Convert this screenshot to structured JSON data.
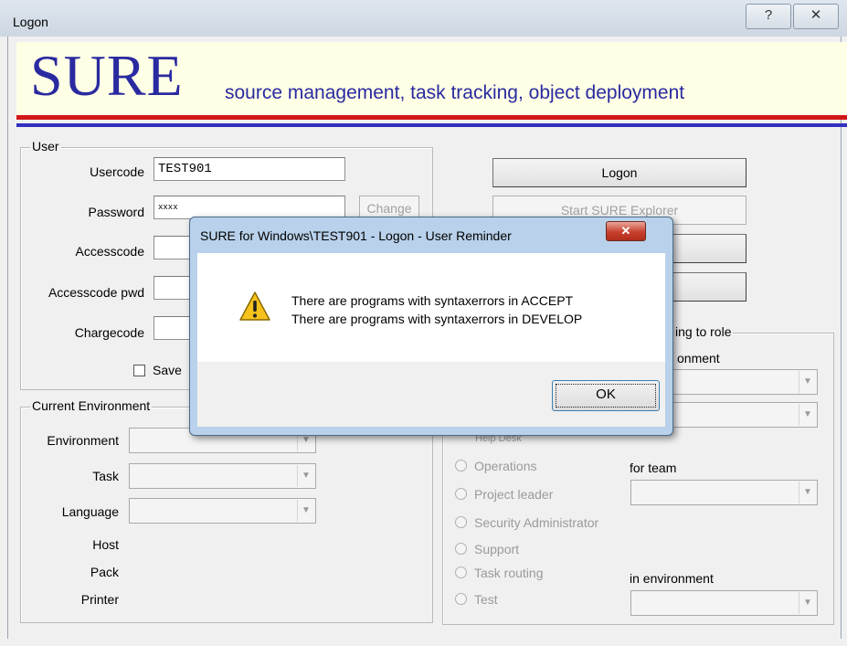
{
  "window": {
    "title": "Logon",
    "help_glyph": "?",
    "close_glyph": "✕"
  },
  "banner": {
    "logo": "SURE",
    "tagline": "source management, task tracking, object deployment"
  },
  "user_group": {
    "title": "User",
    "usercode_label": "Usercode",
    "usercode_value": "TEST901",
    "password_label": "Password",
    "password_value": "xxxx",
    "change_label": "Change",
    "accesscode_label": "Accesscode",
    "accesscode_pwd_label": "Accesscode pwd",
    "chargecode_label": "Chargecode",
    "save_label": "Save"
  },
  "actions": {
    "logon_label": "Logon",
    "start_explorer_label": "Start SURE Explorer"
  },
  "env_group": {
    "title": "Current Environment",
    "environment_label": "Environment",
    "task_label": "Task",
    "language_label": "Language",
    "host_label": "Host",
    "pack_label": "Pack",
    "printer_label": "Printer"
  },
  "role_group": {
    "title_fragment": "ing to role",
    "environment_fragment": "onment",
    "help_desk_fragment": "Help Desk",
    "radios": [
      "Operations",
      "Project leader",
      "Security Administrator",
      "Support",
      "Task routing",
      "Test"
    ],
    "for_team_label": "for team",
    "in_environment_label": "in environment"
  },
  "dialog": {
    "title": "SURE for Windows\\TEST901 - Logon - User Reminder",
    "close_glyph": "✕",
    "message_line1": "There are programs with syntaxerrors in ACCEPT",
    "message_line2": "There are programs with syntaxerrors in DEVELOP",
    "ok_label": "OK",
    "icon": "warning-icon"
  },
  "colors": {
    "brand_blue": "#2a2aa0",
    "banner_bg": "#ffffe6",
    "red_rule": "#d01818",
    "blue_rule": "#3030c0"
  }
}
